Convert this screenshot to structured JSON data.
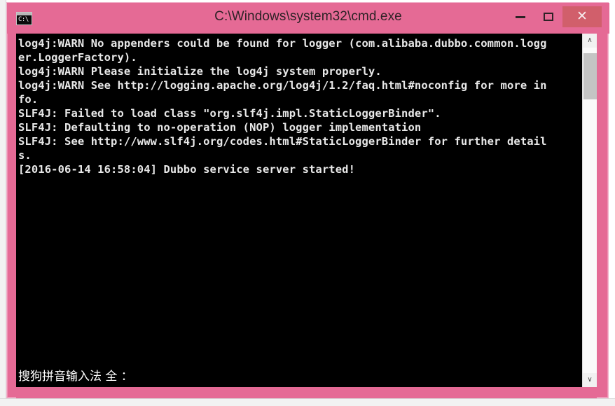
{
  "window": {
    "title": "C:\\Windows\\system32\\cmd.exe",
    "icon_label": "C:\\",
    "icon_name": "cmd-icon",
    "frame_color": "#e56a95",
    "titlebar_text_color": "#2e2226",
    "close_button_color": "#d15f6b",
    "controls": {
      "minimize_label": "–",
      "maximize_label": "□",
      "close_label": "✕"
    }
  },
  "console": {
    "background": "#000000",
    "foreground": "#e8e8e8",
    "lines": [
      "log4j:WARN No appenders could be found for logger (com.alibaba.dubbo.common.logg",
      "er.LoggerFactory).",
      "log4j:WARN Please initialize the log4j system properly.",
      "log4j:WARN See http://logging.apache.org/log4j/1.2/faq.html#noconfig for more in",
      "fo.",
      "SLF4J: Failed to load class \"org.slf4j.impl.StaticLoggerBinder\".",
      "SLF4J: Defaulting to no-operation (NOP) logger implementation",
      "SLF4J: See http://www.slf4j.org/codes.html#StaticLoggerBinder for further detail",
      "s.",
      "[2016-06-14 16:58:04] Dubbo service server started!"
    ]
  },
  "ime": {
    "status_text": "搜狗拼音输入法 全 ："
  },
  "scrollbar": {
    "up_arrow": "∧",
    "down_arrow": "∨",
    "thumb_color": "#c4c4c4",
    "track_color": "#fafafa"
  }
}
